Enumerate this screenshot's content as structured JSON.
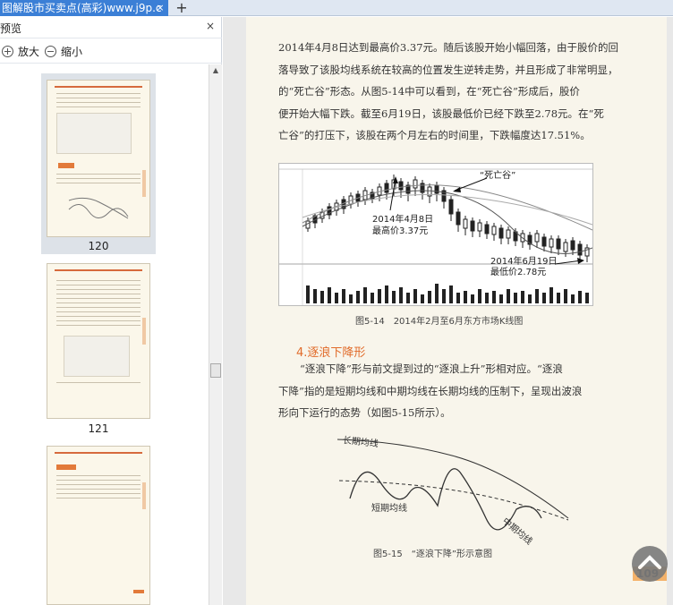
{
  "tabs": [
    {
      "title": "图解股市买卖点(高彩)www.j9p.c",
      "close": "×"
    }
  ],
  "tab_add": "+",
  "panel": {
    "title": "预览",
    "close": "×",
    "zoom_in": "放大",
    "zoom_out": "缩小",
    "thumbnails": [
      {
        "page": "120"
      },
      {
        "page": "121"
      },
      {
        "page": ""
      }
    ]
  },
  "document": {
    "paragraph1": [
      "2014年4月8日达到最高价3.37元。随后该股开始小幅回落，由于股价的回",
      "落导致了该股均线系统在较高的位置发生逆转走势，并且形成了非常明显，",
      "的“死亡谷”形态。从图5-14中可以看到，在“死亡谷”形成后，股价",
      "便开始大幅下跌。截至6月19日，该股最低价已经下跌至2.78元。在“死",
      "亡谷”的打压下，该股在两个月左右的时间里，下跌幅度达17.51%。"
    ],
    "figure1": {
      "annotation_death_valley": "“死亡谷”",
      "annotation_high_1": "2014年4月8日",
      "annotation_high_2": "最高价3.37元",
      "annotation_low_1": "2014年6月19日",
      "annotation_low_2": "最低价2.78元",
      "caption": "图5-14　2014年2月至6月东方市场K线图"
    },
    "section_title": "4.逐浪下降形",
    "paragraph2": [
      "“逐浪下降”形与前文提到过的“逐浪上升”形相对应。“逐浪",
      "下降”指的是短期均线和中期均线在长期均线的压制下，呈现出波浪",
      "形向下运行的态势（如图5-15所示）。"
    ],
    "figure2": {
      "label_long": "长期均线",
      "label_short": "短期均线",
      "label_mid": "中期均线",
      "caption": "图5-15　“逐浪下降”形示意图"
    },
    "page_number": "109"
  },
  "colors": {
    "tab_active": "#3b7fd6",
    "accent_orange": "#e16b2a",
    "page_bg": "#f8f5eb"
  }
}
